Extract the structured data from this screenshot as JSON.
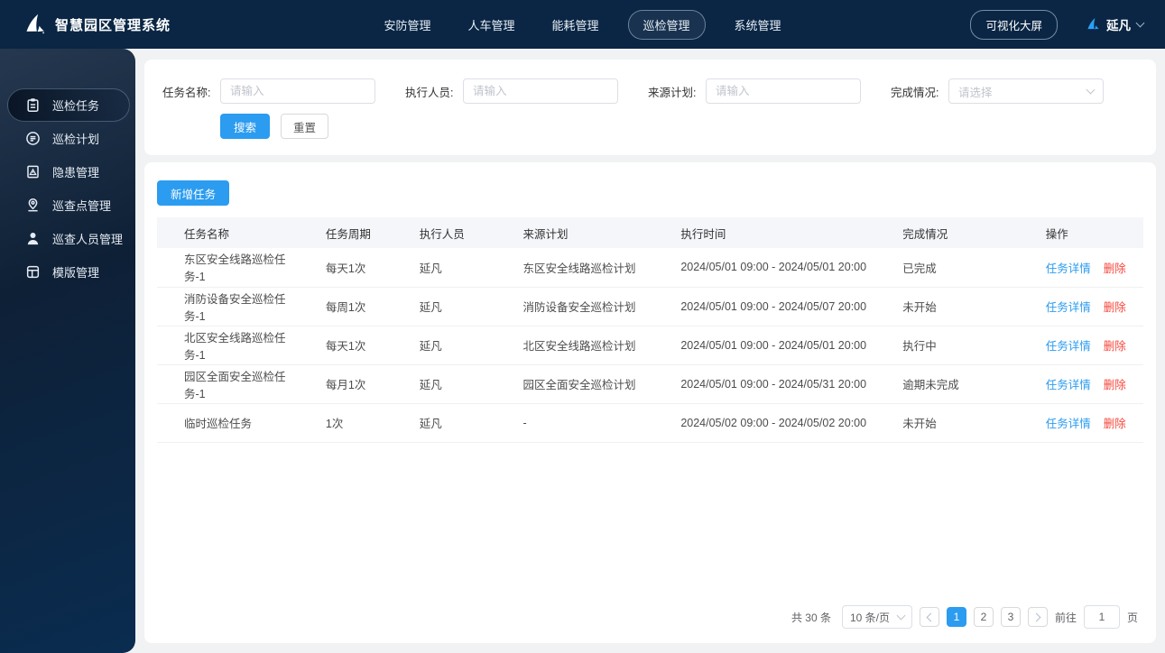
{
  "navbar": {
    "title": "智慧园区管理系统",
    "menu": [
      {
        "label": "安防管理",
        "active": false
      },
      {
        "label": "人车管理",
        "active": false
      },
      {
        "label": "能耗管理",
        "active": false
      },
      {
        "label": "巡检管理",
        "active": true
      },
      {
        "label": "系统管理",
        "active": false
      }
    ],
    "screen_button": "可视化大屏",
    "user_name": "延凡"
  },
  "sidebar": {
    "items": [
      {
        "label": "巡检任务",
        "icon": "clipboard-icon",
        "active": true
      },
      {
        "label": "巡检计划",
        "icon": "plan-circle-icon",
        "active": false
      },
      {
        "label": "隐患管理",
        "icon": "hazard-document-icon",
        "active": false
      },
      {
        "label": "巡查点管理",
        "icon": "location-pin-icon",
        "active": false
      },
      {
        "label": "巡查人员管理",
        "icon": "person-icon",
        "active": false
      },
      {
        "label": "模版管理",
        "icon": "template-grid-icon",
        "active": false
      }
    ]
  },
  "filters": {
    "fields": [
      {
        "label": "任务名称:",
        "placeholder": "请输入",
        "type": "input"
      },
      {
        "label": "执行人员:",
        "placeholder": "请输入",
        "type": "input"
      },
      {
        "label": "来源计划:",
        "placeholder": "请输入",
        "type": "input"
      },
      {
        "label": "完成情况:",
        "placeholder": "请选择",
        "type": "select"
      }
    ],
    "search": "搜索",
    "reset": "重置"
  },
  "toolbar": {
    "add_task": "新增任务"
  },
  "table": {
    "columns": [
      "任务名称",
      "任务周期",
      "执行人员",
      "来源计划",
      "执行时间",
      "完成情况",
      "操作"
    ],
    "actions": {
      "detail": "任务详情",
      "remove": "删除"
    },
    "rows": [
      {
        "name": "东区安全线路巡检任务-1",
        "cycle": "每天1次",
        "executor": "延凡",
        "plan": "东区安全线路巡检计划",
        "time": "2024/05/01 09:00 - 2024/05/01 20:00",
        "status": "已完成"
      },
      {
        "name": "消防设备安全巡检任务-1",
        "cycle": "每周1次",
        "executor": "延凡",
        "plan": "消防设备安全巡检计划",
        "time": "2024/05/01 09:00 - 2024/05/07 20:00",
        "status": "未开始"
      },
      {
        "name": "北区安全线路巡检任务-1",
        "cycle": "每天1次",
        "executor": "延凡",
        "plan": "北区安全线路巡检计划",
        "time": "2024/05/01 09:00 - 2024/05/01 20:00",
        "status": "执行中"
      },
      {
        "name": "园区全面安全巡检任务-1",
        "cycle": "每月1次",
        "executor": "延凡",
        "plan": "园区全面安全巡检计划",
        "time": "2024/05/01 09:00 - 2024/05/31 20:00",
        "status": "逾期未完成"
      },
      {
        "name": "临时巡检任务",
        "cycle": "1次",
        "executor": "延凡",
        "plan": "-",
        "time": "2024/05/02 09:00 - 2024/05/02 20:00",
        "status": "未开始"
      }
    ]
  },
  "pagination": {
    "total": "共 30 条",
    "page_size": "10 条/页",
    "pages": [
      "1",
      "2",
      "3"
    ],
    "current_page": "1",
    "goto_prefix": "前往",
    "goto_value": "1",
    "goto_suffix": "页"
  },
  "colors": {
    "accent": "#2b9cf0",
    "danger": "#f5473c",
    "navbar_bg": "#0a2644",
    "sidebar_top": "#25384f",
    "sidebar_bottom": "#0a2c50",
    "page_bg": "#f1f2f4",
    "table_header_bg": "#f5f6fa"
  }
}
